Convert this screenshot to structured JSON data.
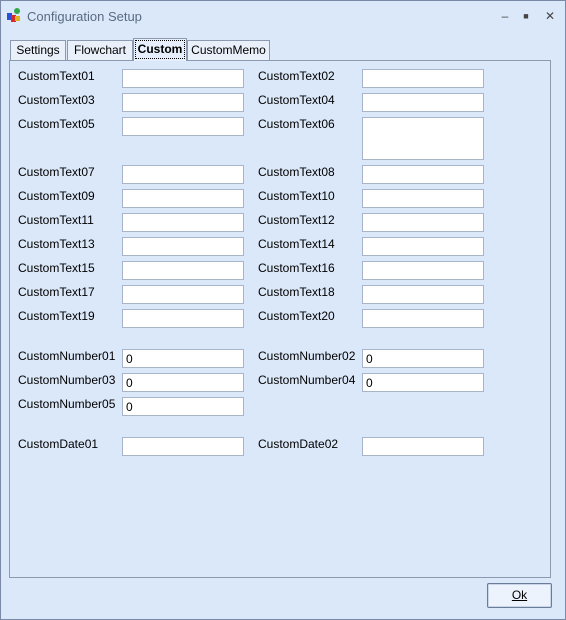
{
  "window": {
    "title": "Configuration Setup",
    "minimize": "–",
    "maximize": "■",
    "close": "✕"
  },
  "tabs": [
    {
      "label": "Settings"
    },
    {
      "label": "Flowchart"
    },
    {
      "label": "Custom",
      "active": true
    },
    {
      "label": "CustomMemo"
    }
  ],
  "fields": {
    "ct01": {
      "label": "CustomText01",
      "value": ""
    },
    "ct02": {
      "label": "CustomText02",
      "value": ""
    },
    "ct03": {
      "label": "CustomText03",
      "value": ""
    },
    "ct04": {
      "label": "CustomText04",
      "value": ""
    },
    "ct05": {
      "label": "CustomText05",
      "value": ""
    },
    "ct06": {
      "label": "CustomText06",
      "value": ""
    },
    "ct07": {
      "label": "CustomText07",
      "value": ""
    },
    "ct08": {
      "label": "CustomText08",
      "value": ""
    },
    "ct09": {
      "label": "CustomText09",
      "value": ""
    },
    "ct10": {
      "label": "CustomText10",
      "value": ""
    },
    "ct11": {
      "label": "CustomText11",
      "value": ""
    },
    "ct12": {
      "label": "CustomText12",
      "value": ""
    },
    "ct13": {
      "label": "CustomText13",
      "value": ""
    },
    "ct14": {
      "label": "CustomText14",
      "value": ""
    },
    "ct15": {
      "label": "CustomText15",
      "value": ""
    },
    "ct16": {
      "label": "CustomText16",
      "value": ""
    },
    "ct17": {
      "label": "CustomText17",
      "value": ""
    },
    "ct18": {
      "label": "CustomText18",
      "value": ""
    },
    "ct19": {
      "label": "CustomText19",
      "value": ""
    },
    "ct20": {
      "label": "CustomText20",
      "value": ""
    },
    "cn01": {
      "label": "CustomNumber01",
      "value": "0"
    },
    "cn02": {
      "label": "CustomNumber02",
      "value": "0"
    },
    "cn03": {
      "label": "CustomNumber03",
      "value": "0"
    },
    "cn04": {
      "label": "CustomNumber04",
      "value": "0"
    },
    "cn05": {
      "label": "CustomNumber05",
      "value": "0"
    },
    "cd01": {
      "label": "CustomDate01",
      "value": ""
    },
    "cd02": {
      "label": "CustomDate02",
      "value": ""
    }
  },
  "ok_button": {
    "label": "Ok"
  }
}
